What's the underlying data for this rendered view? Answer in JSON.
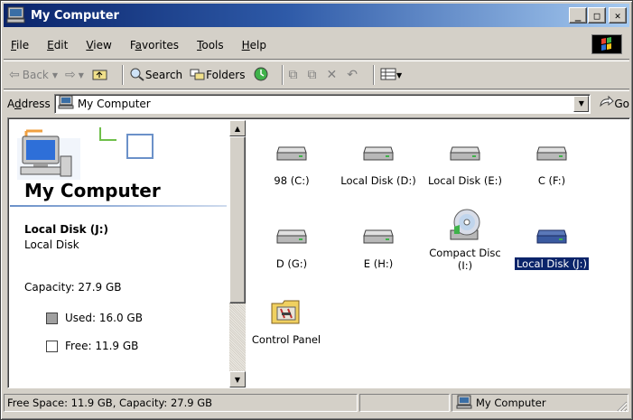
{
  "window": {
    "title": "My Computer",
    "minimize_glyph": "_",
    "maximize_glyph": "□",
    "close_glyph": "✕"
  },
  "menu": [
    {
      "pre": "",
      "ul": "F",
      "post": "ile"
    },
    {
      "pre": "",
      "ul": "E",
      "post": "dit"
    },
    {
      "pre": "",
      "ul": "V",
      "post": "iew"
    },
    {
      "pre": "F",
      "ul": "a",
      "post": "vorites"
    },
    {
      "pre": "",
      "ul": "T",
      "post": "ools"
    },
    {
      "pre": "",
      "ul": "H",
      "post": "elp"
    }
  ],
  "toolbar": {
    "back_label": "Back",
    "search_label": "Search",
    "folders_label": "Folders"
  },
  "address": {
    "label_pre": "A",
    "label_ul": "d",
    "label_post": "dress",
    "value": "My Computer",
    "go_label": "Go"
  },
  "left_pane": {
    "title": "My Computer",
    "selected_name": "Local Disk (J:)",
    "selected_type": "Local Disk",
    "capacity": "Capacity: 27.9 GB",
    "used": "Used: 16.0 GB",
    "free": "Free: 11.9 GB"
  },
  "items": [
    {
      "label": "98 (C:)",
      "kind": "drive"
    },
    {
      "label": "Local Disk (D:)",
      "kind": "drive"
    },
    {
      "label": "Local Disk (E:)",
      "kind": "drive"
    },
    {
      "label": "C (F:)",
      "kind": "drive"
    },
    {
      "label": "D (G:)",
      "kind": "drive"
    },
    {
      "label": "E (H:)",
      "kind": "drive"
    },
    {
      "label": "Compact Disc (I:)",
      "kind": "cd"
    },
    {
      "label": "Local Disk (J:)",
      "kind": "drive-selected"
    },
    {
      "label": "Control Panel",
      "kind": "control-panel"
    }
  ],
  "status": {
    "left": "Free Space: 11.9 GB, Capacity: 27.9 GB",
    "zone": "My Computer"
  },
  "colors": {
    "title_start": "#0a246a",
    "title_end": "#a6caf0",
    "selection": "#0a246a",
    "face": "#d4d0c8"
  }
}
